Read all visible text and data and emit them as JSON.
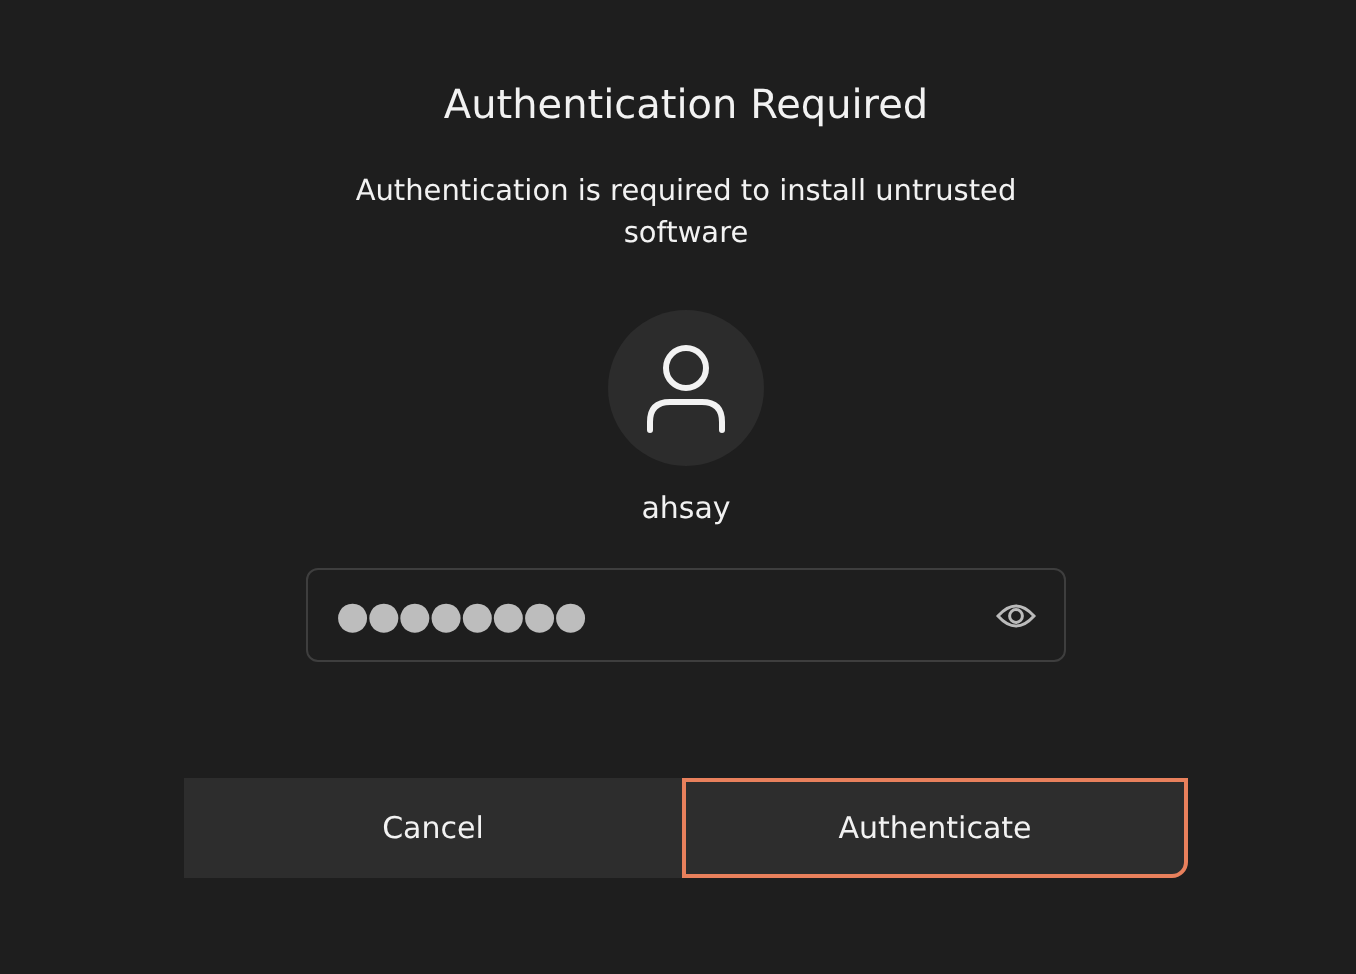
{
  "dialog": {
    "title": "Authentication Required",
    "message": "Authentication is required to install untrusted software",
    "user": {
      "name": "ahsay"
    },
    "password": {
      "value": "●●●●●●●●"
    },
    "buttons": [
      {
        "label": "Cancel",
        "focused": false
      },
      {
        "label": "Authenticate",
        "focused": true
      }
    ]
  }
}
